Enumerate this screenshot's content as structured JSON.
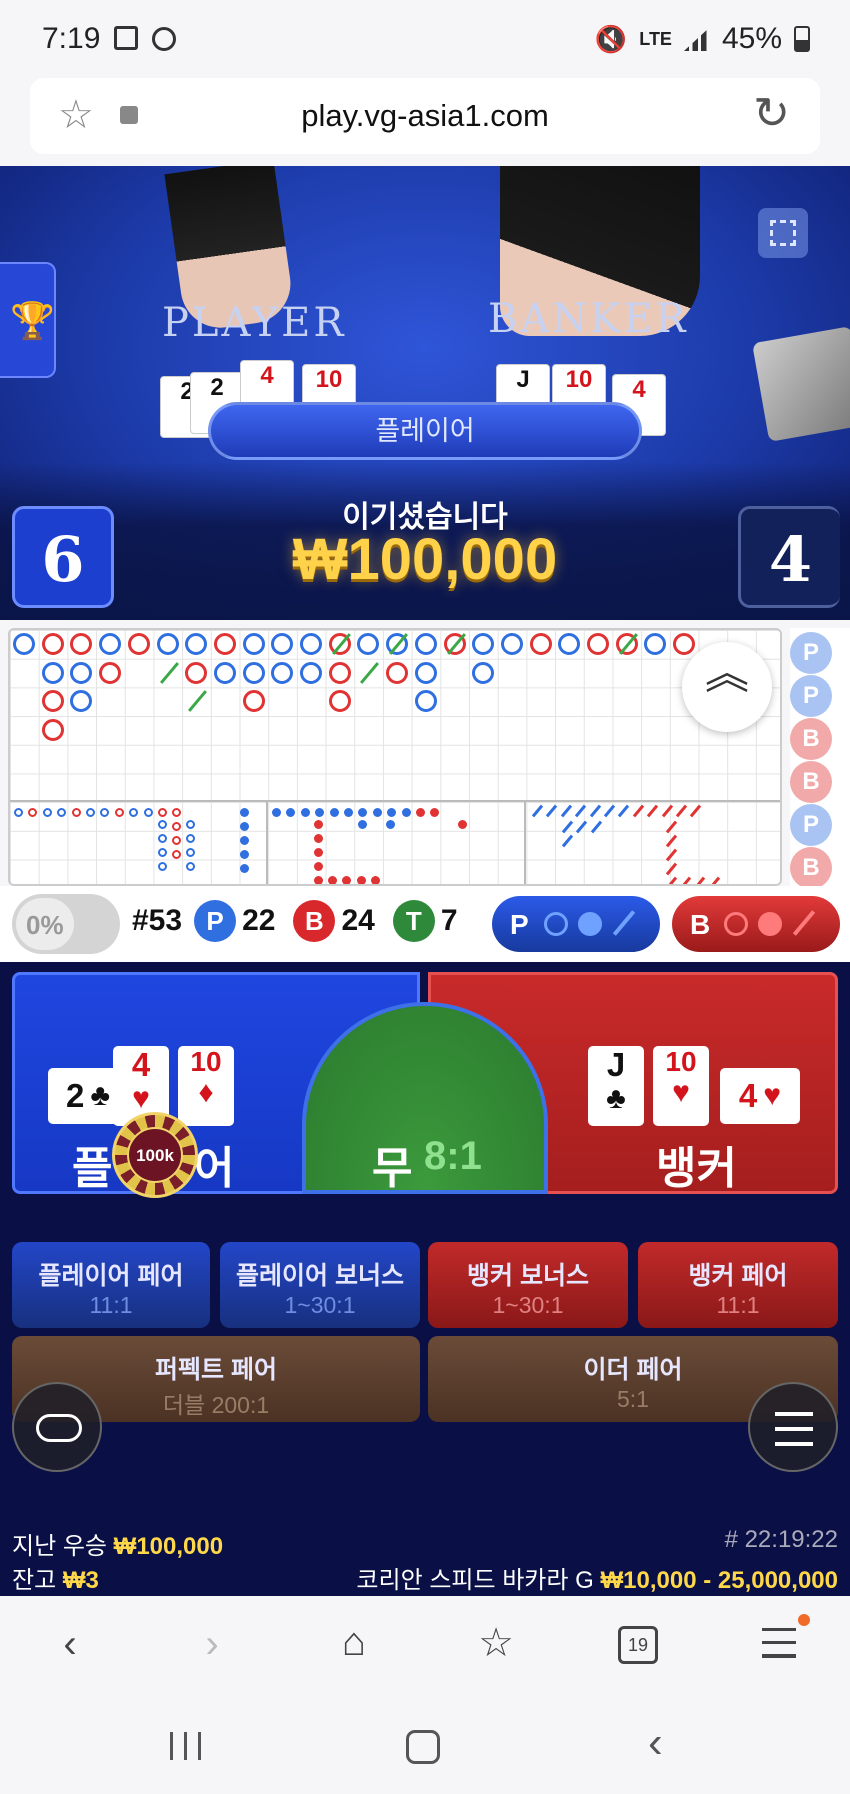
{
  "status_bar": {
    "time": "7:19",
    "network": "LTE",
    "battery": "45%"
  },
  "browser": {
    "url": "play.vg-asia1.com"
  },
  "video": {
    "player_label": "PLAYER",
    "banker_label": "BANKER",
    "player_cards": [
      "2",
      "2",
      "4",
      "10"
    ],
    "banker_cards": [
      "J",
      "10",
      "4"
    ],
    "result_pill": "플레이어",
    "win_message": "이기셨습니다",
    "win_amount": "₩100,000",
    "player_score": "6",
    "banker_score": "4"
  },
  "roadmap": {
    "side_pills": [
      "P",
      "P",
      "B",
      "B",
      "P",
      "B"
    ],
    "colors": {
      "banker": "#e03333",
      "player": "#2f6fe0",
      "tie": "#3aa846"
    }
  },
  "stats": {
    "percent": "0%",
    "round": "#53",
    "p_label": "P",
    "p_count": "22",
    "b_label": "B",
    "b_count": "24",
    "t_label": "T",
    "t_count": "7",
    "p_predict": "P",
    "b_predict": "B"
  },
  "bet": {
    "player_label": "플레이어",
    "player_label_left": "플",
    "player_label_right": "어",
    "chip_label": "100k",
    "tie_label": "무",
    "tie_odds": "8:1",
    "banker_label": "뱅커",
    "player_cards": [
      {
        "rank": "2",
        "suit": "♣",
        "color": "black"
      },
      {
        "rank": "4",
        "suit": "♥",
        "color": "red"
      },
      {
        "rank": "10",
        "suit": "♦",
        "color": "red"
      }
    ],
    "banker_cards": [
      {
        "rank": "J",
        "suit": "♣",
        "color": "black"
      },
      {
        "rank": "10",
        "suit": "♥",
        "color": "red"
      },
      {
        "rank": "4",
        "suit": "♥",
        "color": "red"
      }
    ],
    "side_bets": [
      {
        "name": "플레이어 페어",
        "odds": "11:1"
      },
      {
        "name": "플레이어 보너스",
        "odds": "1~30:1"
      },
      {
        "name": "뱅커 보너스",
        "odds": "1~30:1"
      },
      {
        "name": "뱅커 페어",
        "odds": "11:1"
      }
    ],
    "perfect_pair": {
      "name": "퍼펙트 페어",
      "odds": "더블 200:1"
    },
    "either_pair": {
      "name": "이더 페어",
      "odds": "5:1"
    }
  },
  "footer": {
    "last_win_label": "지난 우승",
    "last_win_value": "₩100,000",
    "balance_label": "잔고",
    "balance_value": "₩3",
    "time": "# 22:19:22",
    "table_name": "코리안 스피드 바카라 G",
    "limits": "₩10,000 - 25,000,000"
  },
  "browser_nav": {
    "tabs_count": "19"
  }
}
